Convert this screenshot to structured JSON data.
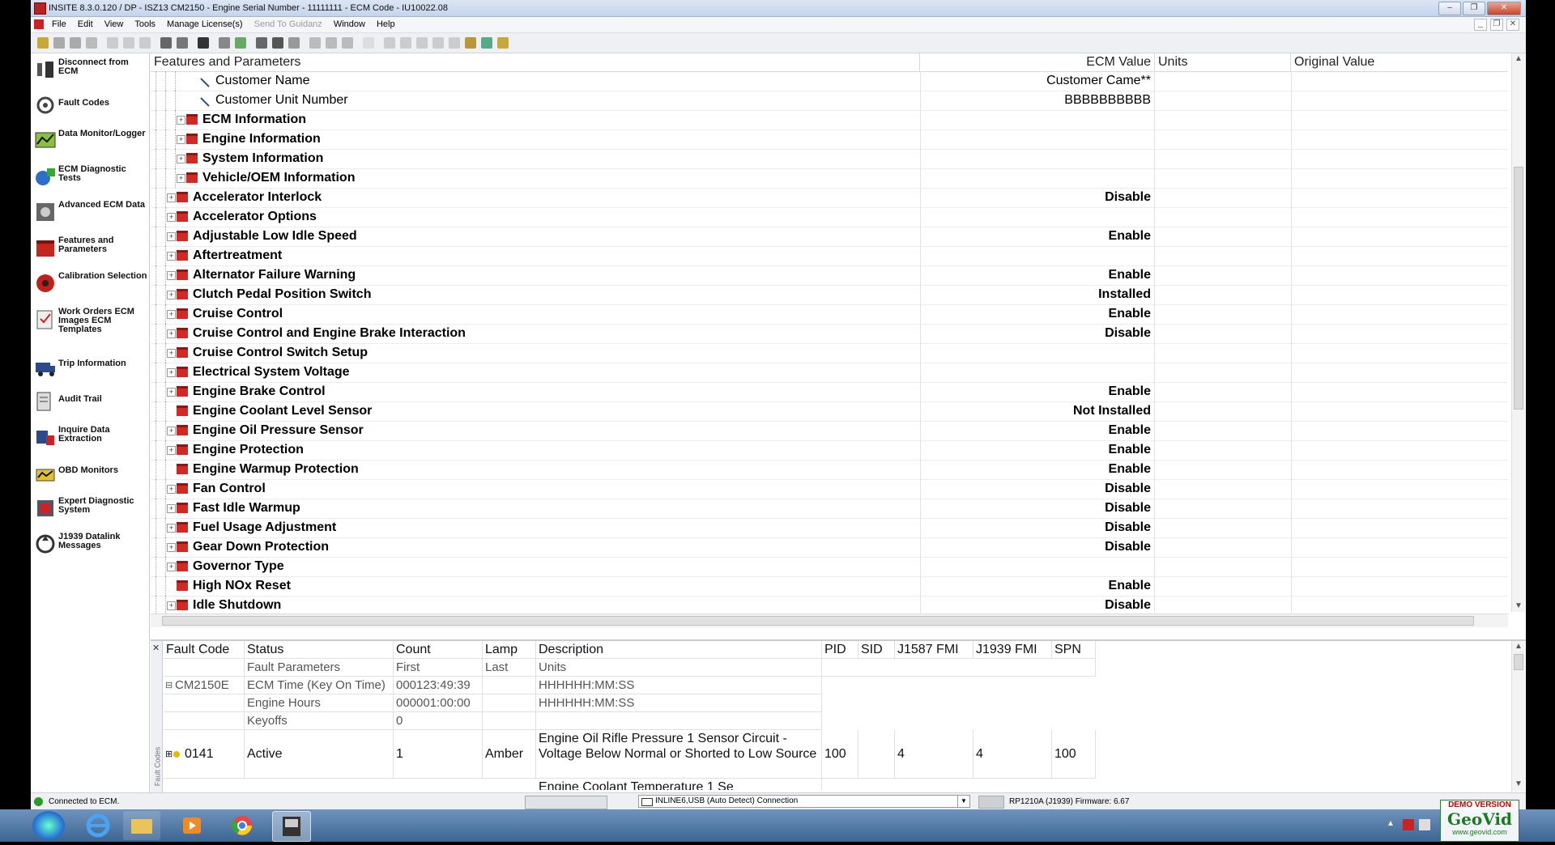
{
  "window": {
    "title": "INSITE 8.3.0.120  / DP - ISZ13 CM2150 - Engine Serial Number - 11111111 - ECM Code - IU10022.08",
    "min": "–",
    "max": "❐",
    "close": "✕"
  },
  "menu": [
    "File",
    "Edit",
    "View",
    "Tools",
    "Manage License(s)",
    "Send To Guidanz",
    "Window",
    "Help"
  ],
  "sidebar": [
    {
      "label": "Disconnect from ECM",
      "icon": "disconnect-icon"
    },
    {
      "label": "Fault Codes",
      "icon": "fault-codes-icon"
    },
    {
      "label": "Data Monitor/Logger",
      "icon": "data-monitor-icon"
    },
    {
      "label": "ECM Diagnostic Tests",
      "icon": "diagnostic-tests-icon"
    },
    {
      "label": "Advanced ECM Data",
      "icon": "advanced-ecm-icon"
    },
    {
      "label": "Features and Parameters",
      "icon": "features-parameters-icon"
    },
    {
      "label": "Calibration Selection",
      "icon": "calibration-icon"
    },
    {
      "label": "Work Orders ECM Images ECM Templates",
      "icon": "work-orders-icon"
    },
    {
      "label": "Trip Information",
      "icon": "trip-information-icon"
    },
    {
      "label": "Audit Trail",
      "icon": "audit-trail-icon"
    },
    {
      "label": "Inquire Data Extraction",
      "icon": "inquire-data-icon"
    },
    {
      "label": "OBD Monitors",
      "icon": "obd-monitors-icon"
    },
    {
      "label": "Expert Diagnostic System",
      "icon": "expert-diagnostic-icon"
    },
    {
      "label": "J1939 Datalink Messages",
      "icon": "j1939-icon"
    }
  ],
  "grid": {
    "headers": [
      "Features and Parameters",
      "ECM Value",
      "Units",
      "Original Value"
    ],
    "rows": [
      {
        "name": "Customer Name",
        "value": "Customer Came**",
        "type": "param",
        "level": 2
      },
      {
        "name": "Customer Unit Number",
        "value": "BBBBBBBBBB",
        "type": "param",
        "level": 2
      },
      {
        "name": "ECM Information",
        "value": "",
        "type": "folder",
        "level": 1,
        "bold": true
      },
      {
        "name": "Engine Information",
        "value": "",
        "type": "folder",
        "level": 1,
        "bold": true
      },
      {
        "name": "System Information",
        "value": "",
        "type": "folder",
        "level": 1,
        "bold": true
      },
      {
        "name": "Vehicle/OEM Information",
        "value": "",
        "type": "folder",
        "level": 1,
        "bold": true
      },
      {
        "name": "Accelerator Interlock",
        "value": "Disable",
        "type": "folder",
        "level": 0
      },
      {
        "name": "Accelerator Options",
        "value": "",
        "type": "folder",
        "level": 0
      },
      {
        "name": "Adjustable Low Idle Speed",
        "value": "Enable",
        "type": "folder",
        "level": 0
      },
      {
        "name": "Aftertreatment",
        "value": "",
        "type": "folder",
        "level": 0
      },
      {
        "name": "Alternator Failure Warning",
        "value": "Enable",
        "type": "folder",
        "level": 0
      },
      {
        "name": "Clutch Pedal Position Switch",
        "value": "Installed",
        "type": "folder",
        "level": 0
      },
      {
        "name": "Cruise Control",
        "value": "Enable",
        "type": "folder",
        "level": 0
      },
      {
        "name": "Cruise Control and Engine Brake Interaction",
        "value": "Disable",
        "type": "folder",
        "level": 0
      },
      {
        "name": "Cruise Control Switch Setup",
        "value": "",
        "type": "folder",
        "level": 0
      },
      {
        "name": "Electrical System Voltage",
        "value": "",
        "type": "folder",
        "level": 0
      },
      {
        "name": "Engine Brake Control",
        "value": "Enable",
        "type": "folder",
        "level": 0
      },
      {
        "name": "Engine Coolant Level Sensor",
        "value": "Not Installed",
        "type": "folder",
        "level": 0,
        "noexp": true
      },
      {
        "name": "Engine Oil Pressure Sensor",
        "value": "Enable",
        "type": "folder",
        "level": 0
      },
      {
        "name": "Engine Protection",
        "value": "Enable",
        "type": "folder",
        "level": 0
      },
      {
        "name": "Engine Warmup Protection",
        "value": "Enable",
        "type": "folder",
        "level": 0,
        "noexp": true
      },
      {
        "name": "Fan Control",
        "value": "Disable",
        "type": "folder",
        "level": 0
      },
      {
        "name": "Fast Idle Warmup",
        "value": "Disable",
        "type": "folder",
        "level": 0
      },
      {
        "name": "Fuel Usage Adjustment",
        "value": "Disable",
        "type": "folder",
        "level": 0
      },
      {
        "name": "Gear Down Protection",
        "value": "Disable",
        "type": "folder",
        "level": 0
      },
      {
        "name": "Governor Type",
        "value": "",
        "type": "folder",
        "level": 0
      },
      {
        "name": "High NOx Reset",
        "value": "Enable",
        "type": "folder",
        "level": 0,
        "noexp": true
      },
      {
        "name": "Idle Shutdown",
        "value": "Disable",
        "type": "folder",
        "level": 0
      }
    ]
  },
  "faults": {
    "tab_label": "Fault Codes",
    "headers": [
      "Fault Code",
      "Status",
      "Count",
      "Lamp",
      "Description",
      "PID",
      "SID",
      "J1587 FMI",
      "J1939 FMI",
      "SPN"
    ],
    "subheaders": [
      "",
      "Fault Parameters",
      "First",
      "Last",
      "Units"
    ],
    "params": [
      {
        "code": "CM2150E",
        "param": "ECM Time (Key On Time)",
        "first": "000123:49:39",
        "units": "HHHHHH:MM:SS"
      },
      {
        "code": "",
        "param": "Engine Hours",
        "first": "000001:00:00",
        "units": "HHHHHH:MM:SS"
      },
      {
        "code": "",
        "param": "Keyoffs",
        "first": "0",
        "units": ""
      }
    ],
    "row": {
      "code": "0141",
      "status": "Active",
      "count": "1",
      "lamp": "Amber",
      "description": "Engine Oil Rifle Pressure 1 Sensor Circuit - Voltage Below Normal or Shorted to Low Source",
      "pid": "100",
      "sid": "",
      "j1587": "4",
      "j1939": "4",
      "spn": "100"
    },
    "cutoff_text": "Engine Coolant Temperature 1 Se"
  },
  "status": {
    "connection": "Connected to ECM.",
    "adapter": "INLINE6,USB (Auto Detect) Connection",
    "firmware": "RP1210A (J1939)  Firmware: 6.67",
    "watermark_top": "DEMO VERSION",
    "watermark_brand": "GeoVid",
    "watermark_url": "www.geovid.com"
  },
  "colors": {
    "folder_red": "#d12a24",
    "taskbar": "#3d6592",
    "titlebar": "#c4d4ea"
  }
}
